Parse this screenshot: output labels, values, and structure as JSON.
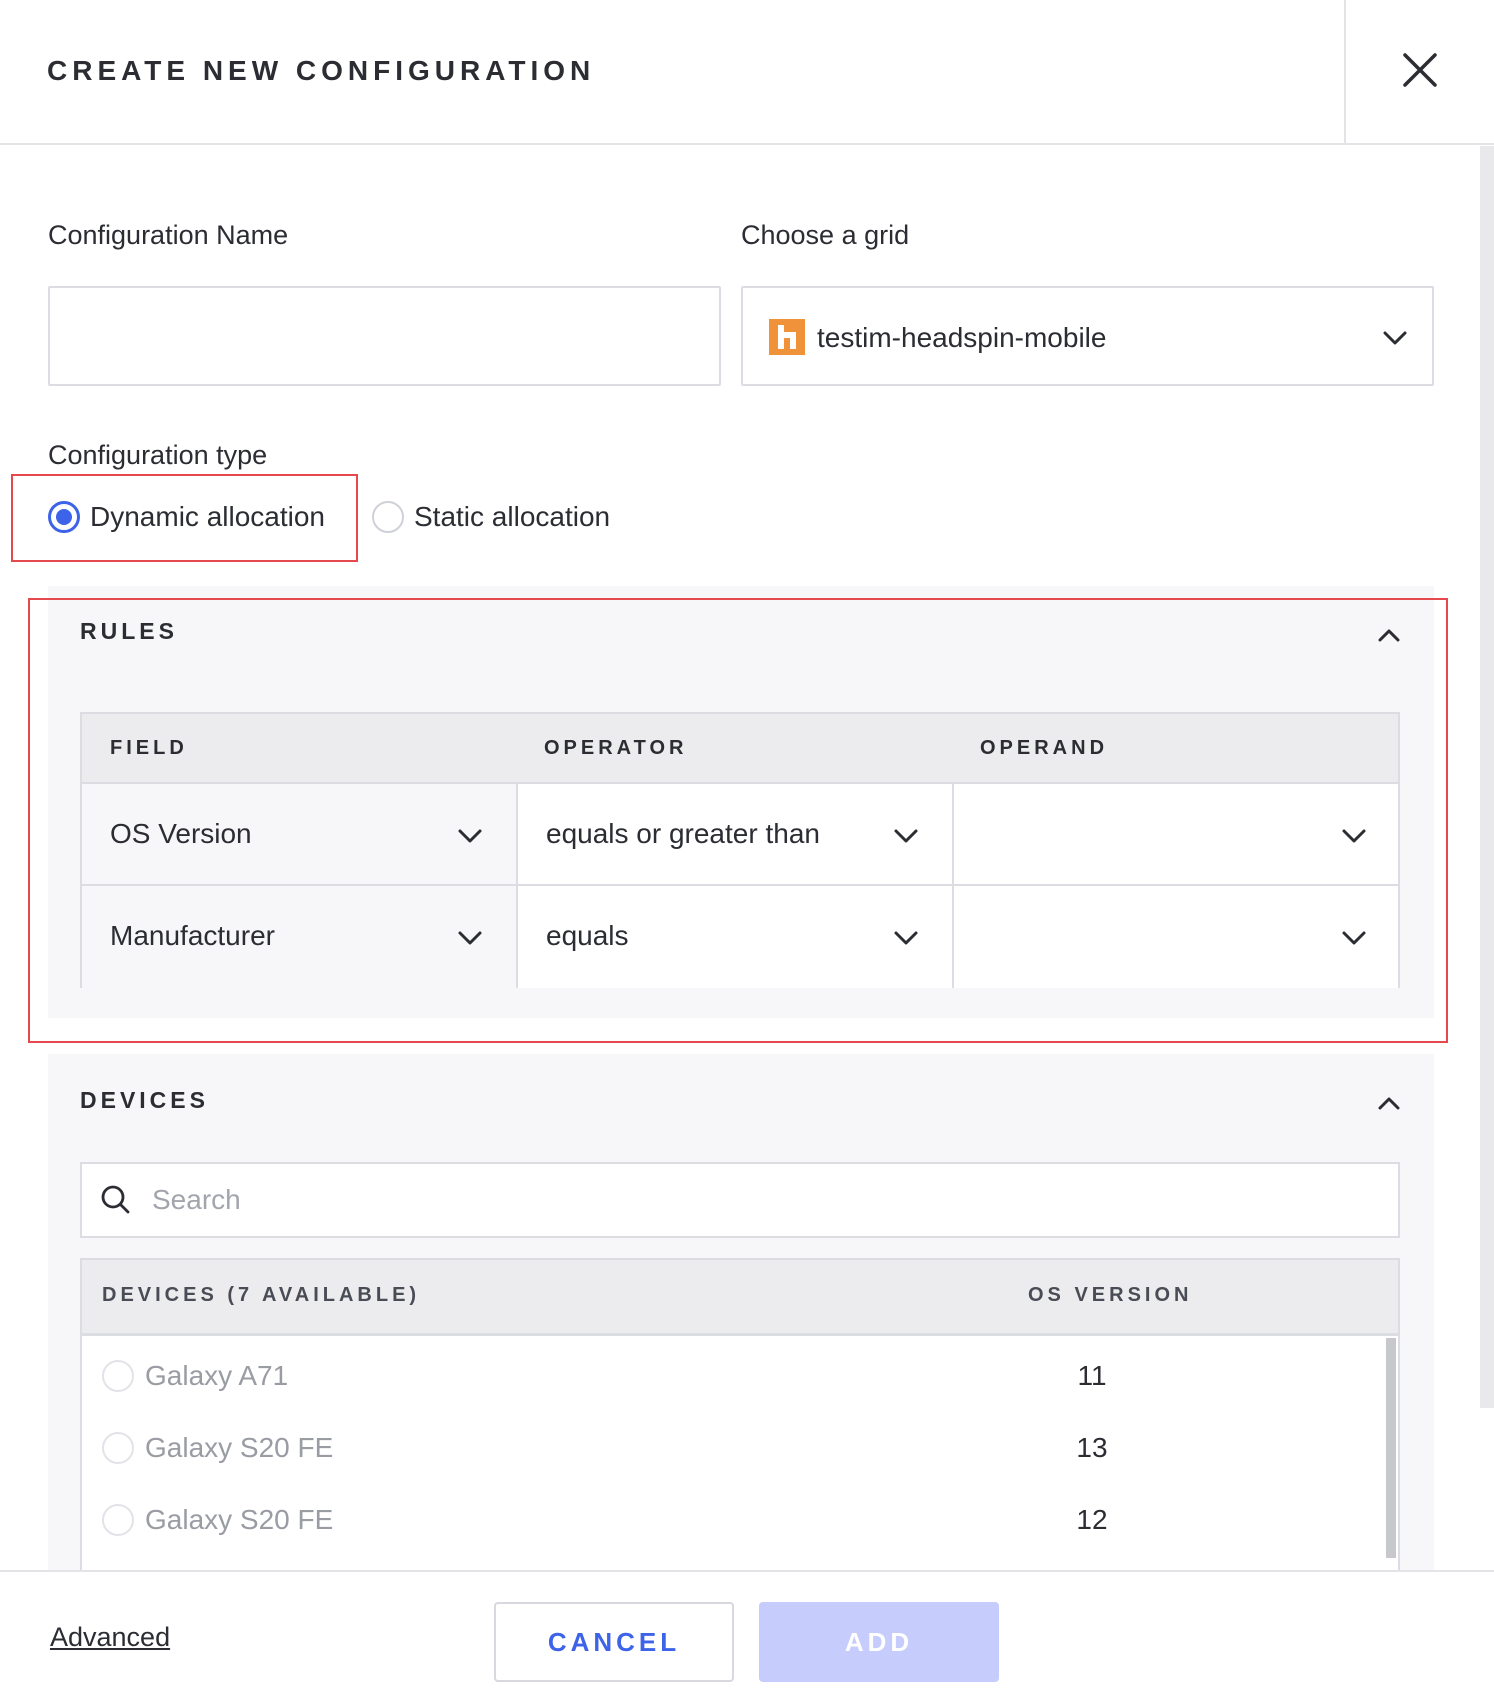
{
  "dialog": {
    "title": "CREATE NEW CONFIGURATION",
    "close_icon": "close-icon"
  },
  "form": {
    "config_name_label": "Configuration Name",
    "config_name_value": "",
    "grid_label": "Choose a grid",
    "grid_value": "testim-headspin-mobile",
    "grid_icon_color": "#f0923a",
    "config_type_label": "Configuration type",
    "config_types": [
      {
        "label": "Dynamic allocation",
        "checked": true
      },
      {
        "label": "Static allocation",
        "checked": false
      }
    ]
  },
  "rules": {
    "title": "RULES",
    "columns": [
      "FIELD",
      "OPERATOR",
      "OPERAND"
    ],
    "rows": [
      {
        "field": "OS Version",
        "operator": "equals or greater than",
        "operand": ""
      },
      {
        "field": "Manufacturer",
        "operator": "equals",
        "operand": ""
      }
    ]
  },
  "devices": {
    "title": "DEVICES",
    "search_placeholder": "Search",
    "columns": [
      "DEVICES (7 AVAILABLE)",
      "OS VERSION"
    ],
    "rows": [
      {
        "name": "Galaxy A71",
        "os": "11"
      },
      {
        "name": "Galaxy S20 FE",
        "os": "13"
      },
      {
        "name": "Galaxy S20 FE",
        "os": "12"
      }
    ]
  },
  "footer": {
    "advanced_label": "Advanced",
    "cancel_label": "CANCEL",
    "add_label": "ADD"
  },
  "colors": {
    "accent": "#3d63e8",
    "highlight": "#e5484d",
    "add_disabled": "#c6ccfb"
  }
}
